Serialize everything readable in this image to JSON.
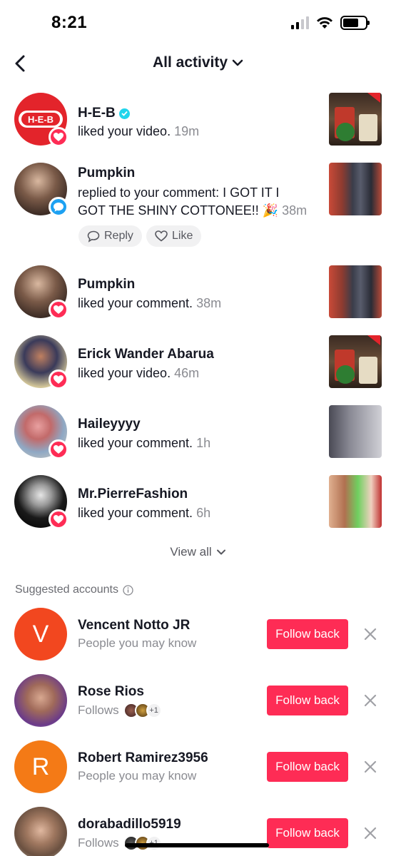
{
  "status_bar": {
    "time": "8:21"
  },
  "header": {
    "title": "All activity"
  },
  "activities": [
    {
      "name": "H-E-B",
      "verified": true,
      "action": "liked your video.",
      "time": "19m",
      "type": "like"
    },
    {
      "name": "Pumpkin",
      "verified": false,
      "action_line1": "replied to your comment: I GOT IT I",
      "action_line2": "GOT THE SHINY COTTONEE!! 🎉",
      "time": "38m",
      "type": "comment",
      "reply_label": "Reply",
      "like_label": "Like"
    },
    {
      "name": "Pumpkin",
      "verified": false,
      "action": "liked your comment.",
      "time": "38m",
      "type": "like"
    },
    {
      "name": "Erick Wander Abarua",
      "verified": false,
      "action": "liked your video.",
      "time": "46m",
      "type": "like"
    },
    {
      "name": "Haileyyyy",
      "verified": false,
      "action": "liked your comment.",
      "time": "1h",
      "type": "like"
    },
    {
      "name": "Mr.PierreFashion",
      "verified": false,
      "action": "liked your comment.",
      "time": "6h",
      "type": "like"
    }
  ],
  "view_all_label": "View all",
  "suggested": {
    "title": "Suggested accounts",
    "accounts": [
      {
        "name": "Vencent Notto JR",
        "initial": "V",
        "subtitle": "People you may know",
        "avatar_color": "#f2471f",
        "button": "Follow back"
      },
      {
        "name": "Rose Rios",
        "initial": "",
        "subtitle": "Follows",
        "mutual_extra": "+1",
        "button": "Follow back"
      },
      {
        "name": "Robert Ramirez3956",
        "initial": "R",
        "subtitle": "People you may know",
        "avatar_color": "#f47a16",
        "button": "Follow back"
      },
      {
        "name": "dorabadillo5919",
        "initial": "",
        "subtitle": "Follows",
        "mutual_extra": "+1",
        "button": "Follow back"
      }
    ]
  },
  "colors": {
    "accent": "#fe2c55",
    "comment_badge": "#1da1f2",
    "verified": "#20d5ec"
  }
}
